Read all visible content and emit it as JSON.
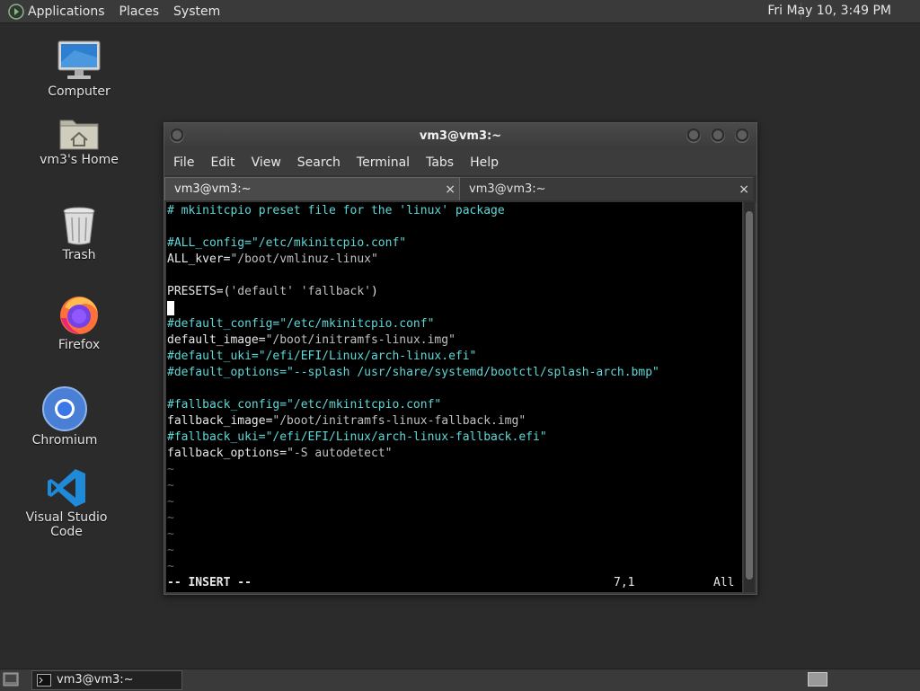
{
  "top_panel": {
    "menus": [
      "Applications",
      "Places",
      "System"
    ],
    "clock": "Fri May 10,  3:49 PM"
  },
  "desktop": {
    "icons": [
      {
        "label": "Computer",
        "icon": "computer-icon"
      },
      {
        "label": "vm3's Home",
        "icon": "home-folder-icon"
      },
      {
        "label": "Trash",
        "icon": "trash-icon"
      },
      {
        "label": "Firefox",
        "icon": "firefox-icon"
      },
      {
        "label": "Chromium",
        "icon": "chromium-icon"
      },
      {
        "label": "Visual Studio Code",
        "icon": "vscode-icon"
      }
    ]
  },
  "window": {
    "title": "vm3@vm3:~",
    "menu": [
      "File",
      "Edit",
      "View",
      "Search",
      "Terminal",
      "Tabs",
      "Help"
    ],
    "tabs": [
      {
        "label": "vm3@vm3:~",
        "close": "×",
        "active": true
      },
      {
        "label": "vm3@vm3:~",
        "close": "×",
        "active": false
      }
    ],
    "editor": {
      "lines": [
        {
          "segments": [
            {
              "text": "# mkinitcpio preset file for the 'linux' package",
              "cls": "c-comment"
            }
          ]
        },
        {
          "segments": []
        },
        {
          "segments": [
            {
              "text": "#ALL_config=\"/etc/mkinitcpio.conf\"",
              "cls": "c-comment"
            }
          ]
        },
        {
          "segments": [
            {
              "text": "ALL_kver=",
              "cls": "c-key"
            },
            {
              "text": "\"/boot/vmlinuz-linux\"",
              "cls": "c-str"
            }
          ]
        },
        {
          "segments": []
        },
        {
          "segments": [
            {
              "text": "PRESETS=(",
              "cls": "c-key"
            },
            {
              "text": "'default' 'fallback'",
              "cls": "c-str"
            },
            {
              "text": ")",
              "cls": "c-key"
            }
          ]
        },
        {
          "segments": [],
          "cursor": true
        },
        {
          "segments": [
            {
              "text": "#default_config=\"/etc/mkinitcpio.conf\"",
              "cls": "c-comment"
            }
          ]
        },
        {
          "segments": [
            {
              "text": "default_image=",
              "cls": "c-key"
            },
            {
              "text": "\"/boot/initramfs-linux.img\"",
              "cls": "c-str"
            }
          ]
        },
        {
          "segments": [
            {
              "text": "#default_uki=\"/efi/EFI/Linux/arch-linux.efi\"",
              "cls": "c-comment"
            }
          ]
        },
        {
          "segments": [
            {
              "text": "#default_options=\"--splash /usr/share/systemd/bootctl/splash-arch.bmp\"",
              "cls": "c-comment"
            }
          ]
        },
        {
          "segments": []
        },
        {
          "segments": [
            {
              "text": "#fallback_config=\"/etc/mkinitcpio.conf\"",
              "cls": "c-comment"
            }
          ]
        },
        {
          "segments": [
            {
              "text": "fallback_image=",
              "cls": "c-key"
            },
            {
              "text": "\"/boot/initramfs-linux-fallback.img\"",
              "cls": "c-str"
            }
          ]
        },
        {
          "segments": [
            {
              "text": "#fallback_uki=\"/efi/EFI/Linux/arch-linux-fallback.efi\"",
              "cls": "c-comment"
            }
          ]
        },
        {
          "segments": [
            {
              "text": "fallback_options=",
              "cls": "c-key"
            },
            {
              "text": "\"-S autodetect\"",
              "cls": "c-str"
            }
          ]
        },
        {
          "segments": [
            {
              "text": "~",
              "cls": "c-tilde"
            }
          ]
        },
        {
          "segments": [
            {
              "text": "~",
              "cls": "c-tilde"
            }
          ]
        },
        {
          "segments": [
            {
              "text": "~",
              "cls": "c-tilde"
            }
          ]
        },
        {
          "segments": [
            {
              "text": "~",
              "cls": "c-tilde"
            }
          ]
        },
        {
          "segments": [
            {
              "text": "~",
              "cls": "c-tilde"
            }
          ]
        },
        {
          "segments": [
            {
              "text": "~",
              "cls": "c-tilde"
            }
          ]
        },
        {
          "segments": [
            {
              "text": "~",
              "cls": "c-tilde"
            }
          ]
        }
      ],
      "status": {
        "mode": "-- INSERT --",
        "position": "7,1",
        "scroll": "All"
      }
    }
  },
  "taskbar": {
    "task_label": "vm3@vm3:~"
  },
  "colors": {
    "comment": "#5fd7d7",
    "panel": "#3a3a3a",
    "terminal_bg": "#000000"
  }
}
